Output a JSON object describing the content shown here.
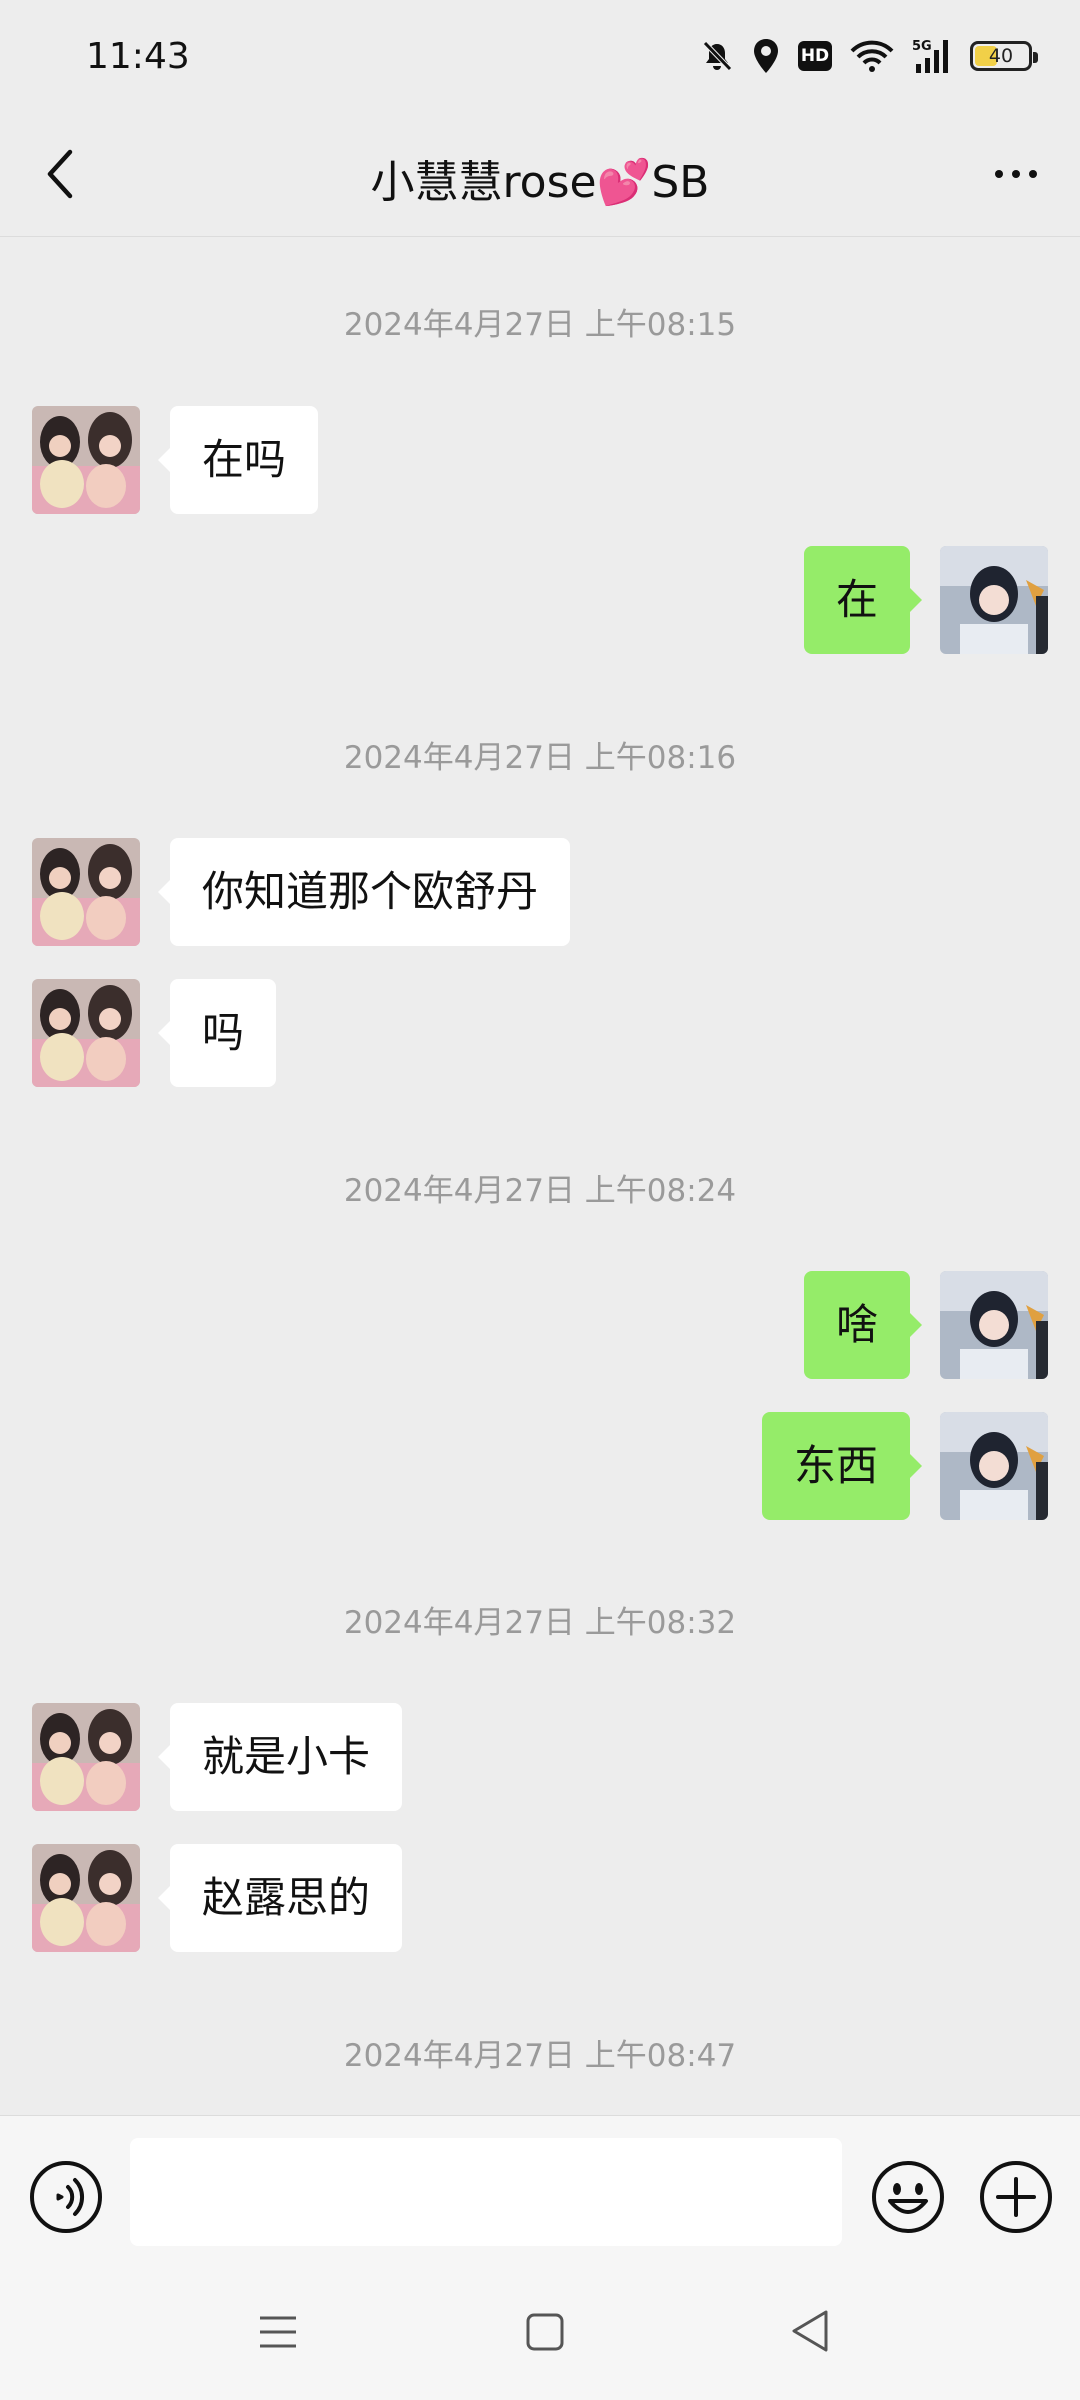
{
  "status_bar": {
    "time": "11:43",
    "icons": [
      "mute-bell-icon",
      "location-icon",
      "hd-icon",
      "wifi-icon",
      "5g-signal-icon"
    ],
    "hd_label": "HD",
    "signal_label": "5G",
    "battery_level": "40",
    "battery_color": "#f1d048"
  },
  "header": {
    "title": "小慧慧rose💕SB",
    "back_icon": "chevron-left-icon",
    "more_icon": "more-dots-icon"
  },
  "messages": [
    {
      "type": "timestamp",
      "text": "2024年4月27日 上午08:15"
    },
    {
      "type": "in",
      "text": "在吗"
    },
    {
      "type": "out",
      "text": "在"
    },
    {
      "type": "timestamp",
      "text": "2024年4月27日 上午08:16"
    },
    {
      "type": "in",
      "text": "你知道那个欧舒丹"
    },
    {
      "type": "in",
      "text": "吗"
    },
    {
      "type": "timestamp",
      "text": "2024年4月27日 上午08:24"
    },
    {
      "type": "out",
      "text": "啥"
    },
    {
      "type": "out",
      "text": "东西"
    },
    {
      "type": "timestamp",
      "text": "2024年4月27日 上午08:32"
    },
    {
      "type": "in",
      "text": "就是小卡"
    },
    {
      "type": "in",
      "text": "赵露思的"
    },
    {
      "type": "timestamp",
      "text": "2024年4月27日 上午08:47"
    }
  ],
  "input_bar": {
    "value": "",
    "placeholder": "",
    "icons": [
      "voice-icon",
      "emoji-icon",
      "plus-icon"
    ]
  },
  "nav_bar": {
    "icons": [
      "menu-icon",
      "home-icon",
      "back-triangle-icon"
    ]
  },
  "colors": {
    "background": "#ededed",
    "outgoing_bubble": "#95ec69",
    "incoming_bubble": "#ffffff",
    "timestamp_text": "#9a9a9a"
  }
}
